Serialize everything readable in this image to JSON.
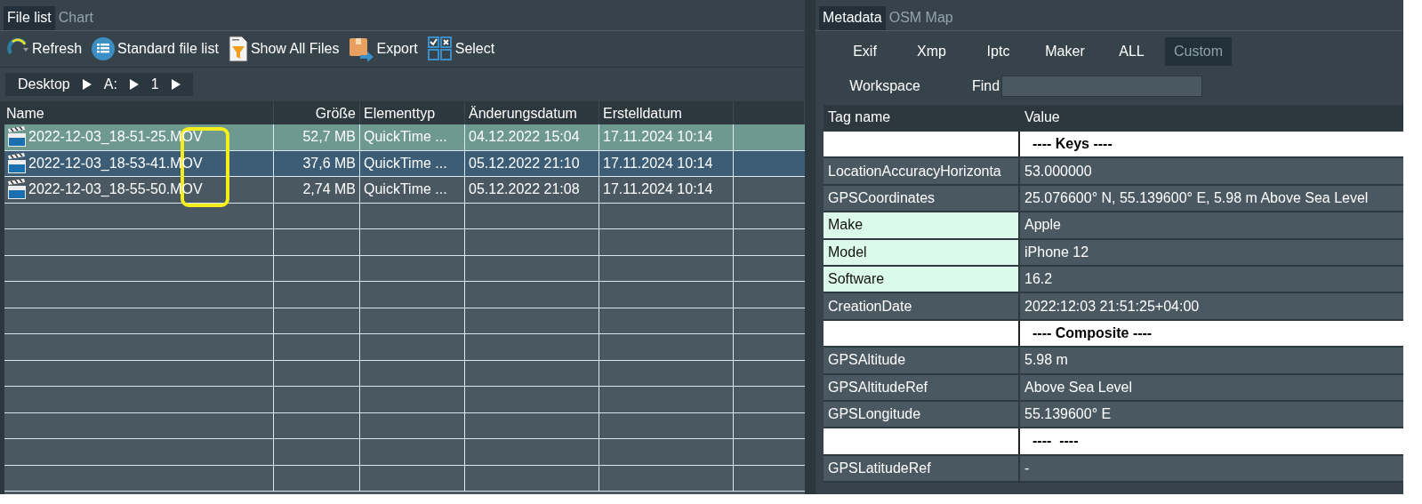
{
  "left_panel": {
    "tabs": [
      {
        "label": "File list",
        "selected": true
      },
      {
        "label": "Chart",
        "selected": false
      }
    ],
    "toolbar": [
      {
        "label": "Refresh",
        "kind": "refresh"
      },
      {
        "label": "Standard file list",
        "kind": "list"
      },
      {
        "label": "Show All Files",
        "kind": "filter"
      },
      {
        "label": "Export",
        "kind": "export"
      },
      {
        "label": "Select",
        "kind": "select"
      }
    ],
    "breadcrumb": [
      "Desktop",
      "A:",
      "1"
    ],
    "table": {
      "columns": [
        "Name",
        "Größe",
        "Elementtyp",
        "Änderungsdatum",
        "Erstelldatum"
      ],
      "rows": [
        {
          "cells": [
            "2022-12-03_18-51-25.MOV",
            "52,7 MB",
            "QuickTime ...",
            "04.12.2022 15:04",
            "17.11.2024 10:14"
          ],
          "selected": true,
          "focused": false
        },
        {
          "cells": [
            "2022-12-03_18-53-41.MOV",
            "37,6 MB",
            "QuickTime ...",
            "05.12.2022 21:10",
            "17.11.2024 10:14"
          ],
          "selected": false,
          "focused": true
        },
        {
          "cells": [
            "2022-12-03_18-55-50.MOV",
            "2,74 MB",
            "QuickTime ...",
            "05.12.2022 21:08",
            "17.11.2024 10:14"
          ],
          "selected": false,
          "focused": false
        }
      ],
      "extension_highlight": true
    }
  },
  "right_panel": {
    "tabs": [
      {
        "label": "Metadata",
        "selected": true
      },
      {
        "label": "OSM Map",
        "selected": false
      }
    ],
    "filter_buttons": [
      {
        "label": "Exif",
        "selected": false
      },
      {
        "label": "Xmp",
        "selected": false
      },
      {
        "label": "Iptc",
        "selected": false
      },
      {
        "label": "Maker",
        "selected": false
      },
      {
        "label": "ALL",
        "selected": false
      },
      {
        "label": "Custom",
        "selected": true
      }
    ],
    "workspace_button": "Workspace",
    "find_label": "Find",
    "table": {
      "columns": [
        "Tag name",
        "Value"
      ],
      "rows": [
        {
          "kind": "section",
          "tag": "",
          "value": "---- Keys ----"
        },
        {
          "kind": "normal",
          "tag": "LocationAccuracyHorizonta",
          "value": "53.000000"
        },
        {
          "kind": "normal",
          "tag": "GPSCoordinates",
          "value": "25.076600° N, 55.139600° E, 5.98 m Above Sea Level"
        },
        {
          "kind": "marked",
          "tag": "Make",
          "value": "Apple"
        },
        {
          "kind": "marked",
          "tag": "Model",
          "value": "iPhone 12"
        },
        {
          "kind": "marked",
          "tag": "Software",
          "value": "16.2"
        },
        {
          "kind": "normal",
          "tag": "CreationDate",
          "value": "2022:12:03 21:51:25+04:00"
        },
        {
          "kind": "section",
          "tag": "",
          "value": "---- Composite ----"
        },
        {
          "kind": "normal",
          "tag": "GPSAltitude",
          "value": "5.98 m"
        },
        {
          "kind": "normal",
          "tag": "GPSAltitudeRef",
          "value": "Above Sea Level"
        },
        {
          "kind": "normal",
          "tag": "GPSLongitude",
          "value": "55.139600° E"
        },
        {
          "kind": "section",
          "tag": "",
          "value": "----  ----"
        },
        {
          "kind": "normal",
          "tag": "GPSLatitudeRef",
          "value": "-"
        }
      ]
    }
  }
}
